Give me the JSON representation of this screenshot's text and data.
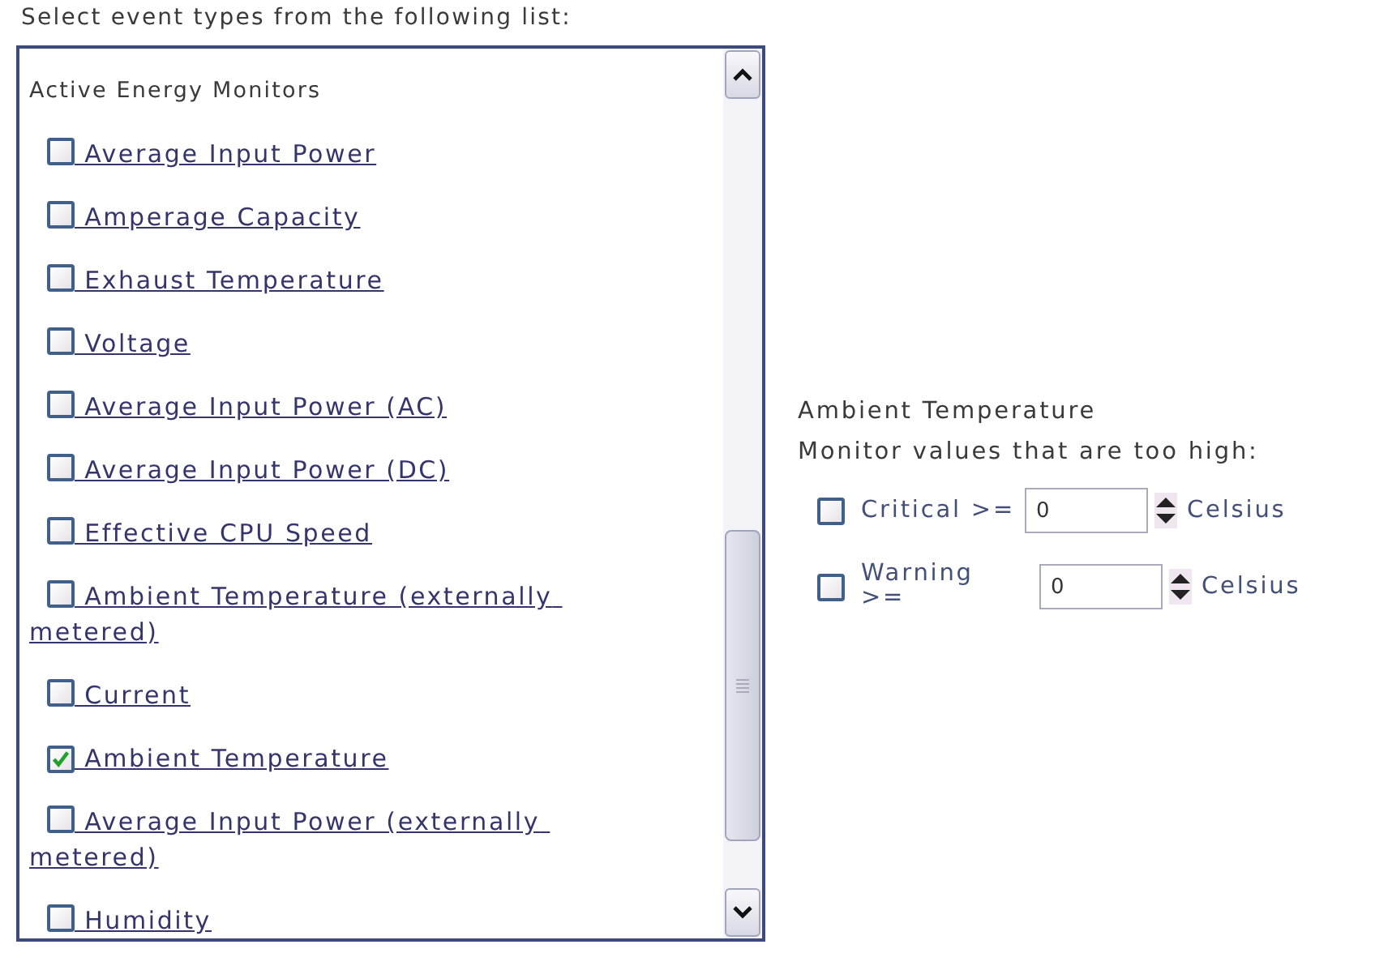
{
  "prompt": "Select event types from the following list:",
  "list": {
    "group": "Active Energy Monitors",
    "items": [
      {
        "label": " Average Input Power",
        "checked": false
      },
      {
        "label": " Amperage Capacity",
        "checked": false
      },
      {
        "label": " Exhaust Temperature",
        "checked": false
      },
      {
        "label": " Voltage",
        "checked": false
      },
      {
        "label": " Average Input Power (AC)",
        "checked": false
      },
      {
        "label": " Average Input Power (DC)",
        "checked": false
      },
      {
        "label": " Effective CPU Speed",
        "checked": false
      },
      {
        "label": " Ambient Temperature (externally metered)",
        "checked": false
      },
      {
        "label": " Current",
        "checked": false
      },
      {
        "label": " Ambient Temperature",
        "checked": true
      },
      {
        "label": " Average Input Power (externally metered)",
        "checked": false
      },
      {
        "label": " Humidity",
        "checked": false
      }
    ]
  },
  "detail": {
    "title": "Ambient Temperature",
    "subtitle": "Monitor values that are too high:",
    "thresholds": [
      {
        "label": "Critical >=",
        "checked": false,
        "value": "0",
        "unit": "Celsius"
      },
      {
        "label": "Warning >=",
        "checked": false,
        "value": "0",
        "unit": "Celsius"
      }
    ]
  }
}
